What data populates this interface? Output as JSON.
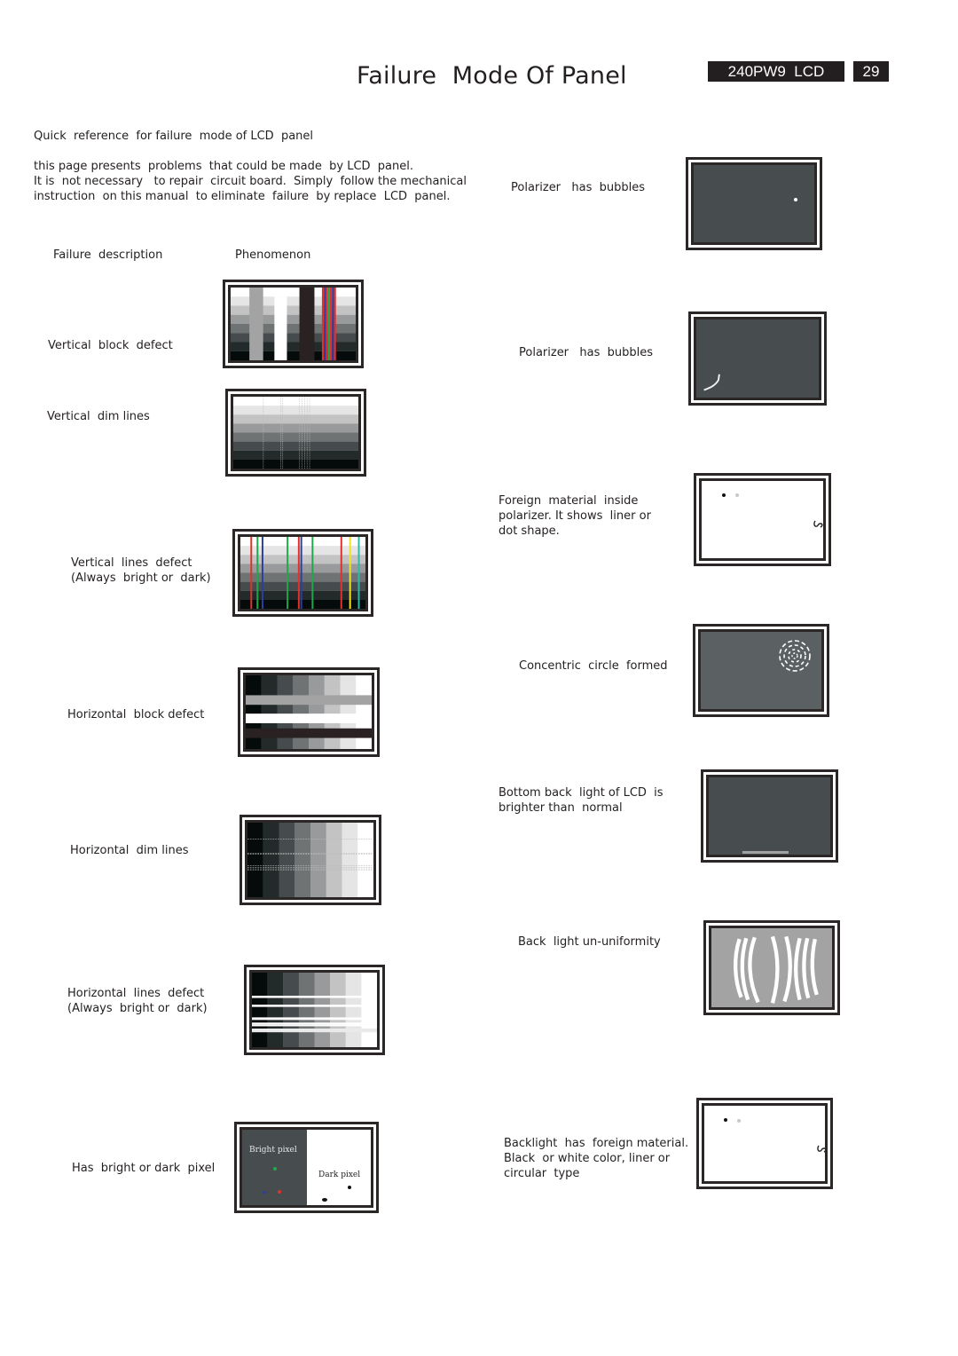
{
  "header": {
    "title": "Failure  Mode Of Panel",
    "model": "240PW9  LCD",
    "page_number": "29"
  },
  "intro": {
    "heading": "Quick  reference  for failure  mode of LCD  panel",
    "lines": [
      "this page presents  problems  that could be made  by LCD  panel.",
      "It is  not necessary   to repair  circuit board.  Simply  follow the mechanical",
      "instruction  on this manual  to eliminate  failure  by replace  LCD  panel."
    ]
  },
  "columns": {
    "description": "Failure  description",
    "phenomenon": "Phenomenon"
  },
  "colors": {
    "text": "#231f20",
    "panel_dark": "#474d4f",
    "panel_frame": "#2b2727",
    "grayscale": [
      "#050b0b",
      "#222a2a",
      "#464c4d",
      "#6f7373",
      "#989a9b",
      "#c3c3c3",
      "#e5e5e5",
      "#ffffff"
    ]
  },
  "left_items": [
    {
      "label": [
        "Vertical  block  defect"
      ]
    },
    {
      "label": [
        "Vertical  dim lines"
      ]
    },
    {
      "label": [
        "Vertical  lines  defect",
        "(Always  bright or  dark)"
      ]
    },
    {
      "label": [
        "Horizontal  block defect"
      ]
    },
    {
      "label": [
        "Horizontal  dim lines"
      ]
    },
    {
      "label": [
        "Horizontal  lines  defect",
        "(Always  bright or  dark)"
      ]
    },
    {
      "label": [
        "Has  bright or dark  pixel"
      ],
      "panel_text": {
        "bright": "Bright pixel",
        "dark": "Dark pixel"
      }
    }
  ],
  "right_items": [
    {
      "label": [
        "Polarizer   has  bubbles"
      ]
    },
    {
      "label": [
        "Polarizer   has  bubbles"
      ]
    },
    {
      "label": [
        "Foreign  material  inside",
        "polarizer. It shows  liner or",
        "dot shape."
      ]
    },
    {
      "label": [
        "Concentric  circle  formed"
      ]
    },
    {
      "label": [
        "Bottom back  light of LCD  is",
        "brighter than  normal"
      ]
    },
    {
      "label": [
        "Back  light un-uniformity"
      ]
    },
    {
      "label": [
        "Backlight  has  foreign material.",
        "Black  or white color, liner or",
        "circular  type"
      ]
    }
  ]
}
